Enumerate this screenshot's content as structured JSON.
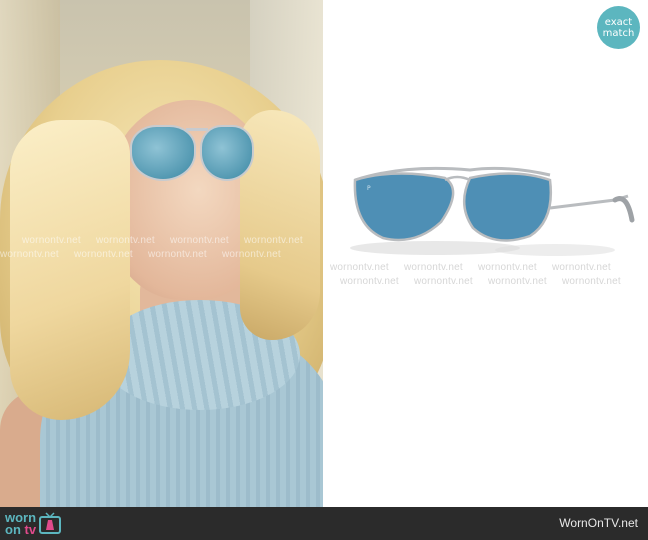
{
  "badge": {
    "line1": "exact",
    "line2": "match",
    "color": "#5cb6bf"
  },
  "watermark": {
    "text": "wornontv.net"
  },
  "logo": {
    "line1": "worn",
    "line2": "on",
    "line3": "tv"
  },
  "footer": {
    "site_name": "WornOnTV.net"
  },
  "product": {
    "name_icon": "aviator-sunglasses",
    "lens_color": "#4e8fb5",
    "frame_color": "#b9bcbf"
  }
}
